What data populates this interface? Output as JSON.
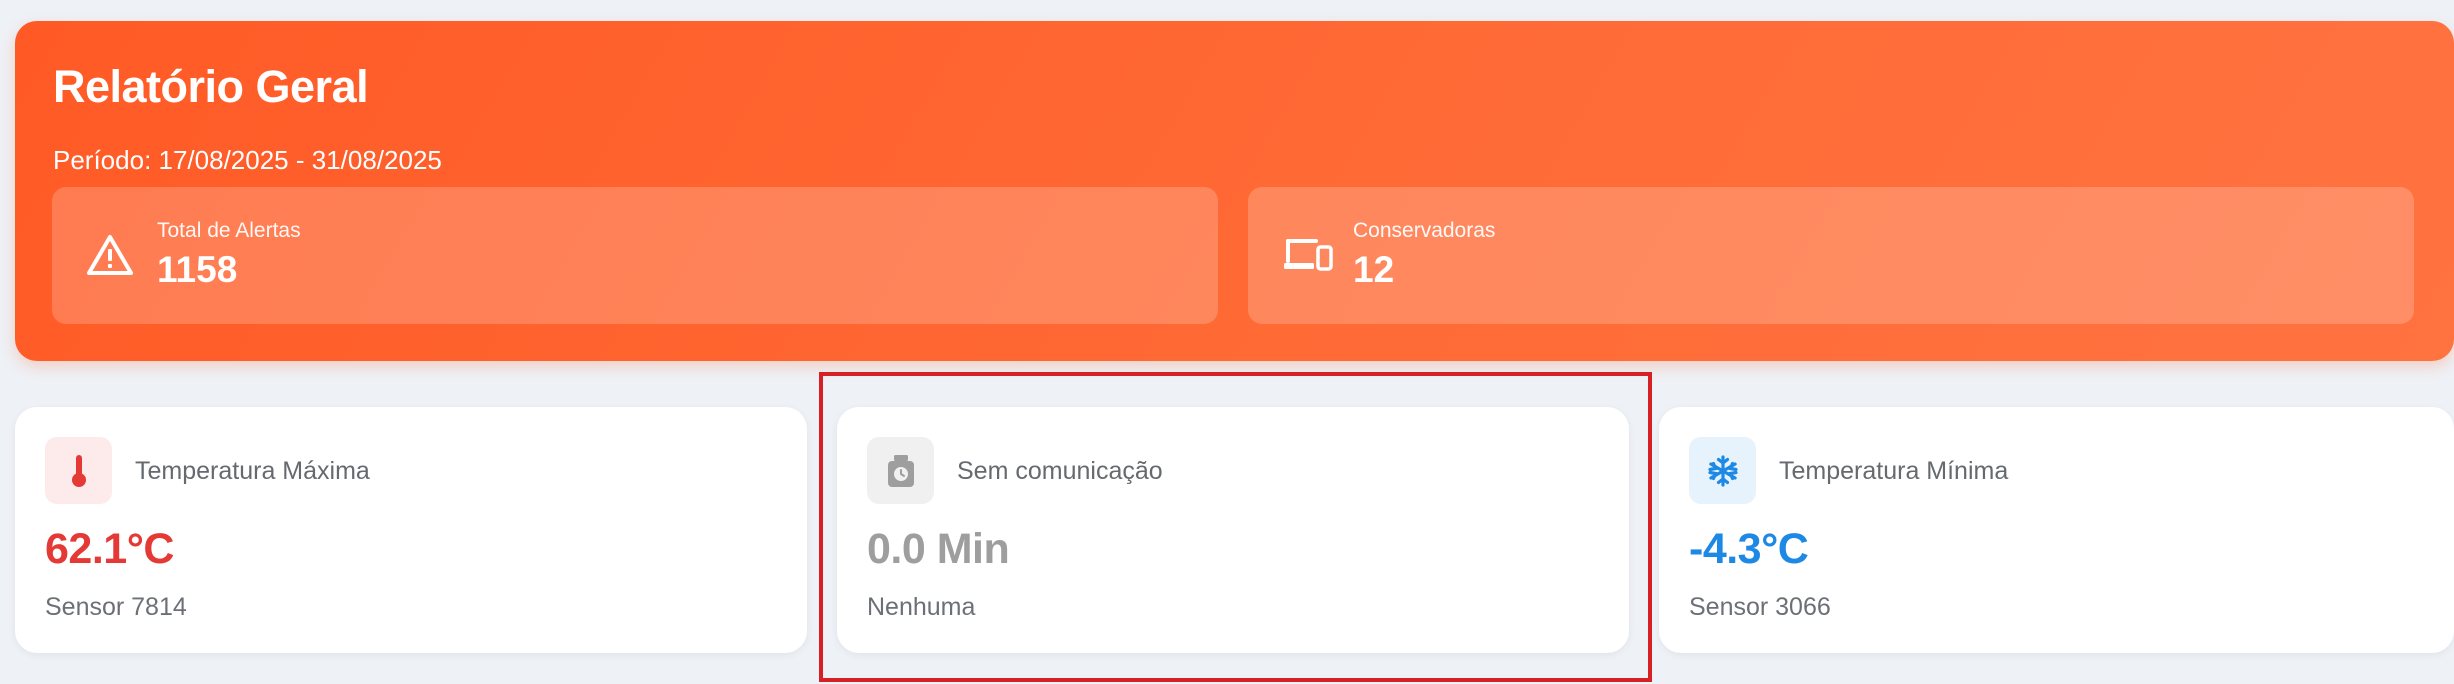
{
  "header": {
    "title": "Relatório Geral",
    "period": "Período: 17/08/2025 - 31/08/2025",
    "background_color": "#ff5c28"
  },
  "stats": [
    {
      "label": "Total de Alertas",
      "value": "1158",
      "icon": "warning-triangle-icon"
    },
    {
      "label": "Conservadoras",
      "value": "12",
      "icon": "devices-icon"
    }
  ],
  "cards": [
    {
      "title": "Temperatura Máxima",
      "value": "62.1°C",
      "sub": "Sensor 7814",
      "icon": "thermometer-icon",
      "accent": "#e53935",
      "icon_bg": "#fdeaea"
    },
    {
      "title": "Sem comunicação",
      "value": "0.0 Min",
      "sub": "Nenhuma",
      "icon": "timer-device-icon",
      "accent": "#9e9e9e",
      "icon_bg": "#f0f0f0"
    },
    {
      "title": "Temperatura Mínima",
      "value": "-4.3°C",
      "sub": "Sensor 3066",
      "icon": "snowflake-icon",
      "accent": "#1e88e5",
      "icon_bg": "#e6f2fc"
    }
  ],
  "highlight": {
    "color": "#d62023"
  }
}
